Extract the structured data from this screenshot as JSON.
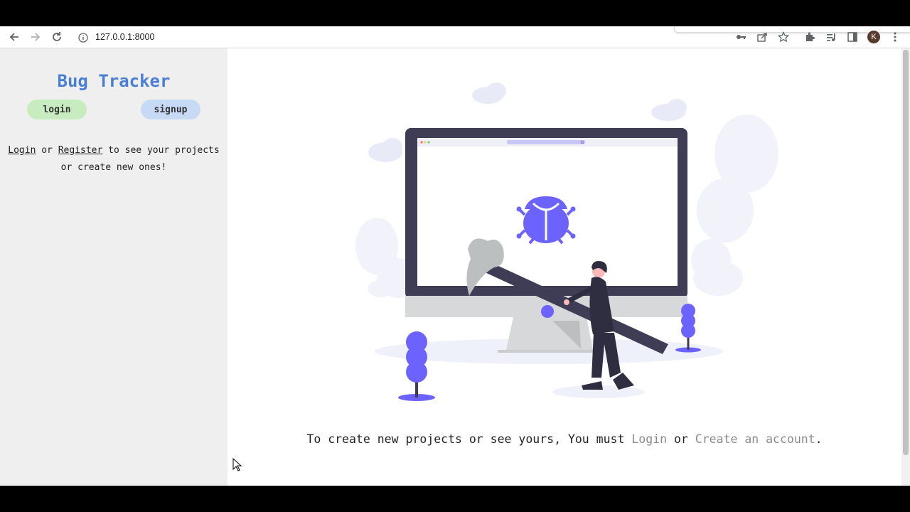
{
  "browser": {
    "url": "127.0.0.1:8000",
    "profile_initial": "K",
    "icons": [
      "back-icon",
      "forward-icon",
      "reload-icon",
      "info-icon",
      "key-icon",
      "share-icon",
      "star-icon",
      "extensions-icon",
      "media-icon",
      "sidepanel-icon",
      "menu-icon"
    ]
  },
  "sidebar": {
    "brand": "Bug Tracker",
    "login_button": "login",
    "signup_button": "signup",
    "message": {
      "login_link": "Login",
      "or": " or ",
      "register_link": "Register",
      "rest": " to see your projects or create new ones!"
    }
  },
  "main": {
    "cta": {
      "prefix": "To create new projects or see yours, You must ",
      "login_link": "Login",
      "or": " or ",
      "create_link": "Create an account",
      "suffix": "."
    }
  },
  "colors": {
    "brand": "#4a7fd4",
    "login_pill": "#c7ecc0",
    "signup_pill": "#c6d9f5",
    "accent_purple": "#6c63ff",
    "link_gray": "#8a8a8a"
  }
}
